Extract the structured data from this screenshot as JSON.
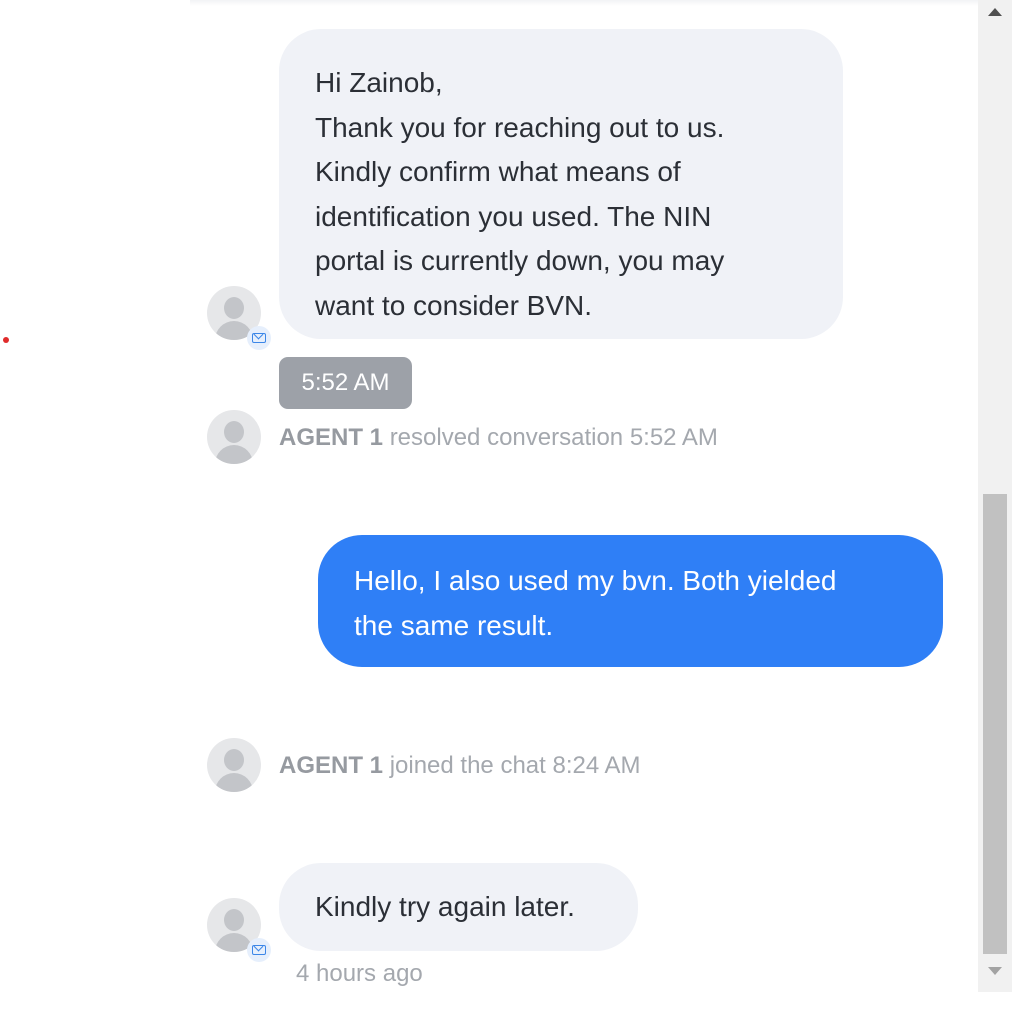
{
  "colors": {
    "outgoing_bubble": "#2f7ff6",
    "incoming_bubble": "#f0f2f7",
    "time_pill": "#9da1a8",
    "notification_dot": "#e02b2b"
  },
  "messages": [
    {
      "sender": "agent",
      "lines": [
        "Hi Zainob,",
        "Thank you for reaching out to us.",
        "Kindly confirm what means of",
        "identification you used. The NIN",
        "portal is currently down, you may",
        "want to consider BVN."
      ],
      "avatar_icon": "user-placeholder-icon",
      "channel_icon": "mail-icon",
      "time": "5:52 AM"
    },
    {
      "sender": "customer",
      "lines": [
        "Hello, I also used my bvn. Both yielded",
        "the same result."
      ]
    },
    {
      "sender": "agent",
      "lines": [
        "Kindly try again later."
      ],
      "avatar_icon": "user-placeholder-icon",
      "channel_icon": "mail-icon",
      "time": "4 hours ago"
    }
  ],
  "events": [
    {
      "agent": "AGENT 1",
      "text": "resolved conversation 5:52 AM"
    },
    {
      "agent": "AGENT 1",
      "text": "joined the chat 8:24 AM"
    }
  ]
}
